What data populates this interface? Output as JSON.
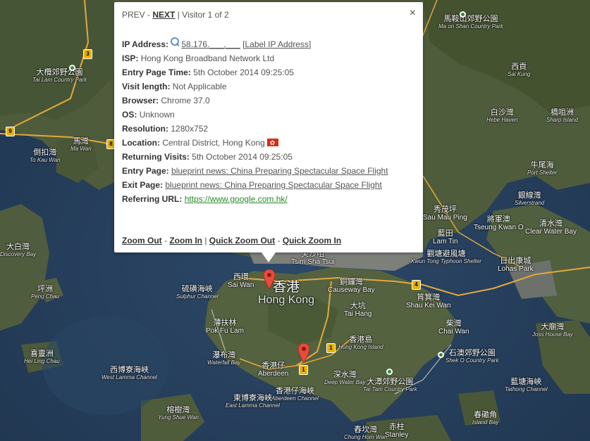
{
  "popup": {
    "prev": "PREV",
    "sep1": " - ",
    "next": "NEXT",
    "counter": " | Visitor 1 of 2",
    "close": "×",
    "ip_label": "IP Address:",
    "ip_value": "58.176.___.___",
    "ip_action": "[Label IP Address]",
    "isp_label": "ISP:",
    "isp_value": "Hong Kong Broadband Network Ltd",
    "entry_time_label": "Entry Page Time:",
    "entry_time_value": "5th October 2014 09:25:05",
    "visit_length_label": "Visit length:",
    "visit_length_value": "Not Applicable",
    "browser_label": "Browser:",
    "browser_value": "Chrome 37.0",
    "os_label": "OS:",
    "os_value": "Unknown",
    "resolution_label": "Resolution:",
    "resolution_value": "1280x752",
    "location_label": "Location:",
    "location_value": "Central District, Hong Kong",
    "returning_label": "Returning Visits:",
    "returning_value": "5th October 2014 09:25:05",
    "entry_page_label": "Entry Page:",
    "entry_page_value": "blueprint news: China Preparing Spectacular Space Flight",
    "exit_page_label": "Exit Page:",
    "exit_page_value": "blueprint news: China Preparing Spectacular Space Flight",
    "referring_label": "Referring URL:",
    "referring_value": "https://www.google.com.hk/",
    "zoom_out": "Zoom Out",
    "zoom_in": "Zoom In",
    "quick_zoom_out": "Quick Zoom Out",
    "quick_zoom_in": "Quick Zoom In",
    "dash": " - ",
    "bar": " | "
  },
  "map_labels": {
    "ma_on_shan": {
      "zh": "馬鞍山郊野公園",
      "en": "Ma on Shan Country Park"
    },
    "tai_lam": {
      "zh": "大欖郊野公園",
      "en": "Tai Lam Country Park"
    },
    "sai_kung": {
      "zh": "西貢",
      "en": "Sai Kung"
    },
    "pak_sha_wan": {
      "zh": "白沙灣",
      "en": "Hebe Haven"
    },
    "kiu_tsui": {
      "zh": "橋咀洲",
      "en": "Sharp Island"
    },
    "ma_wan": {
      "zh": "馬灣",
      "en": "Ma Wan"
    },
    "tau_kau": {
      "zh": "倒扣灣",
      "en": "To Kau Wan"
    },
    "ngau_ngak": {
      "zh": "牛尾海",
      "en": "Port Shelter"
    },
    "silverstrand": {
      "zh": "銀線灣",
      "en": "Silverstrand"
    },
    "sau_mau_ping": {
      "zh": "秀茂坪",
      "en": "Sau Mau Ping"
    },
    "tseung_kwan_o": {
      "zh": "將軍澳",
      "en": "Tseung Kwan O"
    },
    "clear_water_bay": {
      "zh": "清水灣",
      "en": "Clear Water Bay"
    },
    "lam_tin": {
      "zh": "藍田",
      "en": "Lam Tin"
    },
    "discovery_bay": {
      "zh": "大白灣",
      "en": "Discovery Bay"
    },
    "tsim_sha_tsui": {
      "zh": "尖沙咀",
      "en": "Tsim Sha Tsui"
    },
    "kwun_tong": {
      "zh": "觀塘避風塘",
      "en": "Kwun Tong Typhoon Shelter"
    },
    "lohas": {
      "zh": "日出康城",
      "en": "Lohas Park"
    },
    "peng_chau": {
      "zh": "坪洲",
      "en": "Peng Chau"
    },
    "sai_wan": {
      "zh": "西環",
      "en": "Sai Wan"
    },
    "hong_kong": {
      "zh": "香港",
      "en": "Hong Kong"
    },
    "causeway_bay": {
      "zh": "銅鑼灣",
      "en": "Causeway Bay"
    },
    "sulphur": {
      "zh": "硫磺海峽",
      "en": "Sulphur Channel"
    },
    "shau_kei_wan": {
      "zh": "筲箕灣",
      "en": "Shau Kei Wan"
    },
    "tai_hang": {
      "zh": "大坑",
      "en": "Tai Hang"
    },
    "pok_fu_lam": {
      "zh": "薄扶林",
      "en": "Pok Fu Lam"
    },
    "chai_wan": {
      "zh": "柴灣",
      "en": "Chai Wan"
    },
    "joss_house": {
      "zh": "大廟灣",
      "en": "Joss House Bay"
    },
    "hk_island": {
      "zh": "香港島",
      "en": "Hong Kong Island"
    },
    "hei_ling_chau": {
      "zh": "喜靈洲",
      "en": "Hei Ling Chau"
    },
    "waterfall_bay": {
      "zh": "瀑布灣",
      "en": "Waterfall Bay"
    },
    "aberdeen": {
      "zh": "香港仔",
      "en": "Aberdeen"
    },
    "shek_o": {
      "zh": "石澳郊野公園",
      "en": "Shek O Country Park"
    },
    "west_lamma": {
      "zh": "西博寮海峽",
      "en": "West Lamma Channel"
    },
    "deep_water": {
      "zh": "深水灣",
      "en": "Deep Water Bay"
    },
    "aberdeen_ch": {
      "zh": "香港仔海峽",
      "en": "Aberdeen Channel"
    },
    "tai_tam": {
      "zh": "大潭郊野公園",
      "en": "Tai Tam Country Park"
    },
    "tathong": {
      "zh": "藍塘海峽",
      "en": "Tathong Channel"
    },
    "east_lamma": {
      "zh": "東博寮海峽",
      "en": "East Lamma Channel"
    },
    "yung_shue": {
      "zh": "榕樹灣",
      "en": "Yung Shue Wan"
    },
    "stanley": {
      "zh": "赤柱",
      "en": "Stanley"
    },
    "chung_hom": {
      "zh": "舂坎灣",
      "en": "Chung Hom Wan"
    },
    "island_bay": {
      "zh": "春磡角",
      "en": "Island Bay"
    }
  },
  "shields": {
    "s3": "3",
    "s9": "9",
    "s8": "8",
    "s4": "4",
    "s1a": "1",
    "s1b": "1"
  }
}
